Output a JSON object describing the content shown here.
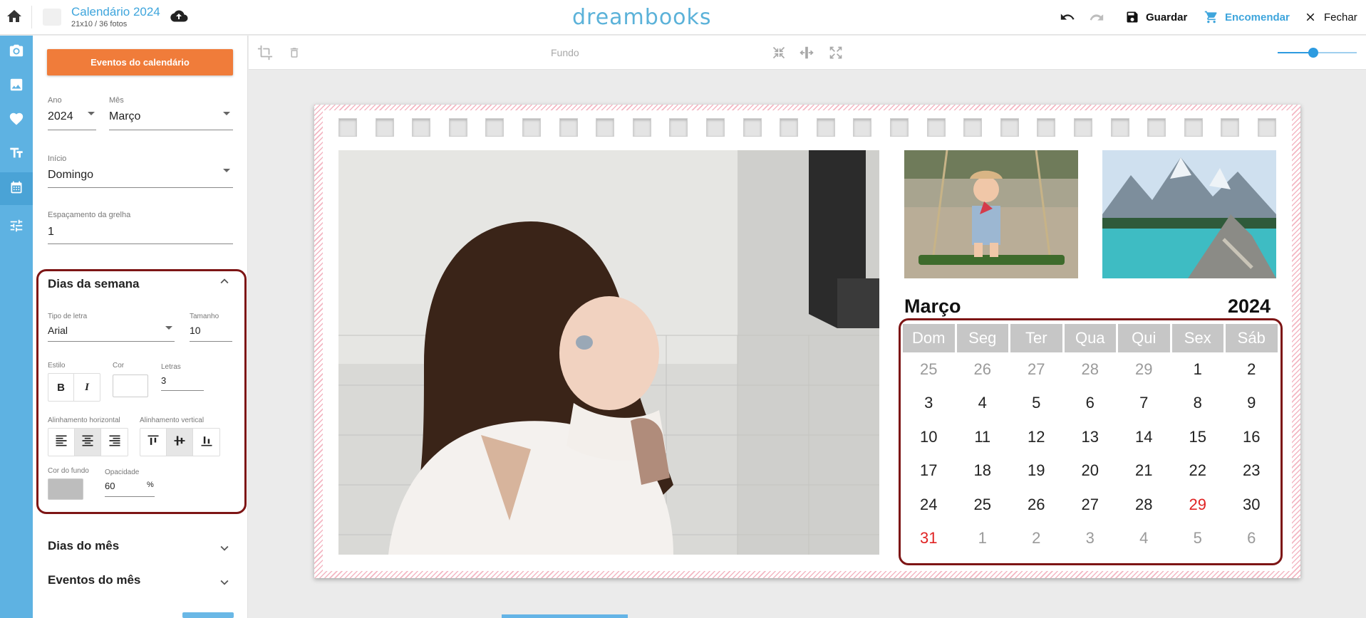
{
  "topbar": {
    "project_title": "Calendário 2024",
    "project_subtitle": "21x10 / 36 fotos",
    "logo": "dreambooks",
    "save_label": "Guardar",
    "order_label": "Encomendar",
    "close_label": "Fechar",
    "accent": "#3ea5dc",
    "order_color": "#3ea5dc"
  },
  "rail": {
    "icons": [
      "camera-icon",
      "image-icon",
      "heart-icon",
      "text-icon",
      "calendar-icon",
      "sliders-icon"
    ],
    "active": "calendar-icon"
  },
  "panel": {
    "events_button": "Eventos do calendário",
    "year": {
      "label": "Ano",
      "value": "2024"
    },
    "month": {
      "label": "Mês",
      "value": "Março"
    },
    "start": {
      "label": "Início",
      "value": "Domingo"
    },
    "spacing": {
      "label": "Espaçamento da grelha",
      "value": "1"
    },
    "weekdays_section": {
      "title": "Dias da semana",
      "font_label": "Tipo de letra",
      "font_value": "Arial",
      "size_label": "Tamanho",
      "size_value": "10",
      "style_label": "Estilo",
      "bold": "B",
      "italic": "I",
      "color_label": "Cor",
      "letters_label": "Letras",
      "letters_value": "3",
      "halign_label": "Alinhamento horizontal",
      "valign_label": "Alinhamento vertical",
      "bg_label": "Cor do fundo",
      "bg_color": "#bdbdbd",
      "opacity_label": "Opacidade",
      "opacity_value": "60",
      "opacity_unit": "%"
    },
    "days_section": {
      "title": "Dias do mês"
    },
    "events_section": {
      "title": "Eventos do mês"
    }
  },
  "toolbar": {
    "fundo_label": "Fundo",
    "zoom_fraction": 0.45
  },
  "calendar": {
    "month": "Março",
    "year": "2024",
    "weekdays": [
      "Dom",
      "Seg",
      "Ter",
      "Qua",
      "Qui",
      "Sex",
      "Sáb"
    ],
    "weeks": [
      [
        {
          "d": "25",
          "s": "dim"
        },
        {
          "d": "26",
          "s": "dim"
        },
        {
          "d": "27",
          "s": "dim"
        },
        {
          "d": "28",
          "s": "dim"
        },
        {
          "d": "29",
          "s": "dim"
        },
        {
          "d": "1",
          "s": ""
        },
        {
          "d": "2",
          "s": ""
        }
      ],
      [
        {
          "d": "3",
          "s": ""
        },
        {
          "d": "4",
          "s": ""
        },
        {
          "d": "5",
          "s": ""
        },
        {
          "d": "6",
          "s": ""
        },
        {
          "d": "7",
          "s": ""
        },
        {
          "d": "8",
          "s": ""
        },
        {
          "d": "9",
          "s": ""
        }
      ],
      [
        {
          "d": "10",
          "s": ""
        },
        {
          "d": "11",
          "s": ""
        },
        {
          "d": "12",
          "s": ""
        },
        {
          "d": "13",
          "s": ""
        },
        {
          "d": "14",
          "s": ""
        },
        {
          "d": "15",
          "s": ""
        },
        {
          "d": "16",
          "s": ""
        }
      ],
      [
        {
          "d": "17",
          "s": ""
        },
        {
          "d": "18",
          "s": ""
        },
        {
          "d": "19",
          "s": ""
        },
        {
          "d": "20",
          "s": ""
        },
        {
          "d": "21",
          "s": ""
        },
        {
          "d": "22",
          "s": ""
        },
        {
          "d": "23",
          "s": ""
        }
      ],
      [
        {
          "d": "24",
          "s": ""
        },
        {
          "d": "25",
          "s": ""
        },
        {
          "d": "26",
          "s": ""
        },
        {
          "d": "27",
          "s": ""
        },
        {
          "d": "28",
          "s": ""
        },
        {
          "d": "29",
          "s": "red"
        },
        {
          "d": "30",
          "s": ""
        }
      ],
      [
        {
          "d": "31",
          "s": "red"
        },
        {
          "d": "1",
          "s": "dim"
        },
        {
          "d": "2",
          "s": "dim"
        },
        {
          "d": "3",
          "s": "dim"
        },
        {
          "d": "4",
          "s": "dim"
        },
        {
          "d": "5",
          "s": "dim"
        },
        {
          "d": "6",
          "s": "dim"
        }
      ]
    ],
    "highlight_color": "#e02323"
  }
}
